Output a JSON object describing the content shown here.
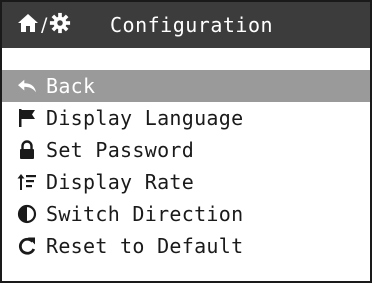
{
  "header": {
    "title": "Configuration",
    "home_icon": "home-icon",
    "separator": "/",
    "settings_icon": "gear-icon"
  },
  "menu": {
    "items": [
      {
        "label": "Back",
        "icon": "back-arrow-icon",
        "selected": true
      },
      {
        "label": "Display Language",
        "icon": "flag-icon",
        "selected": false
      },
      {
        "label": "Set Password",
        "icon": "lock-icon",
        "selected": false
      },
      {
        "label": "Display Rate",
        "icon": "sort-icon",
        "selected": false
      },
      {
        "label": "Switch Direction",
        "icon": "contrast-icon",
        "selected": false
      },
      {
        "label": "Reset to Default",
        "icon": "reset-icon",
        "selected": false
      }
    ]
  },
  "colors": {
    "titlebar_bg": "#3c3c3c",
    "selected_bg": "#9a9a9a",
    "text": "#1a1a1a",
    "inverse_text": "#ffffff"
  }
}
